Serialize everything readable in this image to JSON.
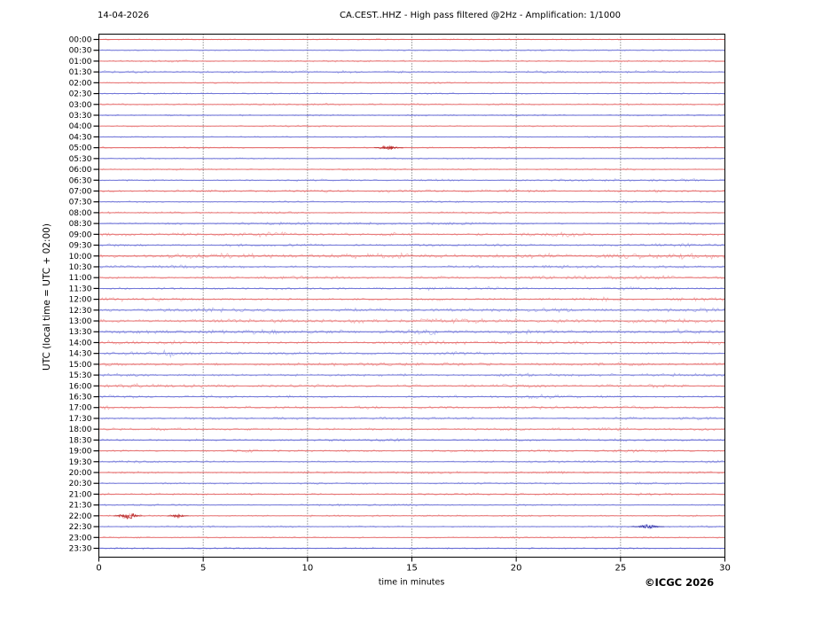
{
  "chart_data": {
    "type": "line",
    "subtype": "helicorder-seismogram",
    "date": "14-04-2026",
    "title": "CA.CEST..HHZ - High pass filtered @2Hz - Amplification: 1/1000",
    "station": "CA.CEST..HHZ",
    "filter": "High pass filtered @2Hz",
    "amplification": "1/1000",
    "ylabel": "UTC (local time = UTC + 02:00)",
    "xlabel": "time in minutes",
    "x_range_minutes": [
      0,
      30
    ],
    "x_ticks": [
      0,
      5,
      10,
      15,
      20,
      25,
      30
    ],
    "grid_minutes": [
      5,
      10,
      15,
      20,
      25
    ],
    "row_interval_minutes": 30,
    "grid_on": true,
    "colors": {
      "red_fuzz": "#f49b9b",
      "red_core": "#e05a5a",
      "red_dark": "#b32020",
      "blue_fuzz": "#9aa0ea",
      "blue_core": "#5a5fd0",
      "blue_dark": "#2828a0",
      "grid": "#444444",
      "frame": "#000000"
    },
    "rows": [
      {
        "label": "00:00",
        "color": "red",
        "noise": 0.55,
        "events": []
      },
      {
        "label": "00:30",
        "color": "blue",
        "noise": 0.5,
        "events": []
      },
      {
        "label": "01:00",
        "color": "red",
        "noise": 0.6,
        "events": []
      },
      {
        "label": "01:30",
        "color": "blue",
        "noise": 0.8,
        "events": []
      },
      {
        "label": "02:00",
        "color": "red",
        "noise": 0.55,
        "events": []
      },
      {
        "label": "02:30",
        "color": "blue",
        "noise": 0.5,
        "events": []
      },
      {
        "label": "03:00",
        "color": "red",
        "noise": 0.6,
        "events": []
      },
      {
        "label": "03:30",
        "color": "blue",
        "noise": 0.5,
        "events": []
      },
      {
        "label": "04:00",
        "color": "red",
        "noise": 0.55,
        "events": []
      },
      {
        "label": "04:30",
        "color": "blue",
        "noise": 0.5,
        "events": []
      },
      {
        "label": "05:00",
        "color": "red",
        "noise": 0.6,
        "events": [
          {
            "t": 13.9,
            "amp": 1.6,
            "w": 0.35
          }
        ]
      },
      {
        "label": "05:30",
        "color": "blue",
        "noise": 0.5,
        "events": []
      },
      {
        "label": "06:00",
        "color": "red",
        "noise": 0.6,
        "events": []
      },
      {
        "label": "06:30",
        "color": "blue",
        "noise": 0.7,
        "events": []
      },
      {
        "label": "07:00",
        "color": "red",
        "noise": 0.9,
        "events": []
      },
      {
        "label": "07:30",
        "color": "blue",
        "noise": 0.7,
        "events": []
      },
      {
        "label": "08:00",
        "color": "red",
        "noise": 0.7,
        "events": []
      },
      {
        "label": "08:30",
        "color": "blue",
        "noise": 0.7,
        "events": []
      },
      {
        "label": "09:00",
        "color": "red",
        "noise": 0.9,
        "events": [
          {
            "t": 8,
            "amp": 0.8,
            "w": 1.2
          },
          {
            "t": 22.5,
            "amp": 0.8,
            "w": 0.8
          }
        ]
      },
      {
        "label": "09:30",
        "color": "blue",
        "noise": 0.9,
        "events": [
          {
            "t": 6.5,
            "amp": 0.6,
            "w": 0.8
          }
        ]
      },
      {
        "label": "10:00",
        "color": "red",
        "noise": 1.5,
        "events": []
      },
      {
        "label": "10:30",
        "color": "blue",
        "noise": 0.95,
        "events": []
      },
      {
        "label": "11:00",
        "color": "red",
        "noise": 1.1,
        "events": []
      },
      {
        "label": "11:30",
        "color": "blue",
        "noise": 0.9,
        "events": [
          {
            "t": 1,
            "amp": 0.9,
            "w": 0.4
          },
          {
            "t": 8.8,
            "amp": 0.7,
            "w": 0.5
          }
        ]
      },
      {
        "label": "12:00",
        "color": "red",
        "noise": 1.05,
        "events": [
          {
            "t": 24,
            "amp": 0.7,
            "w": 0.6
          }
        ]
      },
      {
        "label": "12:30",
        "color": "blue",
        "noise": 1.25,
        "events": [
          {
            "t": 3.3,
            "amp": 0.9,
            "w": 0.4
          }
        ]
      },
      {
        "label": "13:00",
        "color": "red",
        "noise": 1.3,
        "events": [
          {
            "t": 20,
            "amp": 0.9,
            "w": 0.7
          }
        ]
      },
      {
        "label": "13:30",
        "color": "blue",
        "noise": 1.35,
        "events": [
          {
            "t": 8.3,
            "amp": 1.0,
            "w": 0.5
          },
          {
            "t": 16,
            "amp": 1.0,
            "w": 0.8
          },
          {
            "t": 20,
            "amp": 1.1,
            "w": 0.6
          },
          {
            "t": 27.5,
            "amp": 0.8,
            "w": 0.5
          }
        ]
      },
      {
        "label": "14:00",
        "color": "red",
        "noise": 1.15,
        "events": [
          {
            "t": 15,
            "amp": 0.8,
            "w": 0.7
          }
        ]
      },
      {
        "label": "14:30",
        "color": "blue",
        "noise": 0.95,
        "events": [
          {
            "t": 3.3,
            "amp": 1.0,
            "w": 0.5
          }
        ]
      },
      {
        "label": "15:00",
        "color": "red",
        "noise": 1.1,
        "events": []
      },
      {
        "label": "15:30",
        "color": "blue",
        "noise": 0.95,
        "events": []
      },
      {
        "label": "16:00",
        "color": "red",
        "noise": 1.05,
        "events": []
      },
      {
        "label": "16:30",
        "color": "blue",
        "noise": 0.95,
        "events": [
          {
            "t": 21.3,
            "amp": 0.9,
            "w": 0.8
          }
        ]
      },
      {
        "label": "17:00",
        "color": "red",
        "noise": 0.9,
        "events": [
          {
            "t": 0.5,
            "amp": 0.8,
            "w": 0.4
          }
        ]
      },
      {
        "label": "17:30",
        "color": "blue",
        "noise": 0.85,
        "events": []
      },
      {
        "label": "18:00",
        "color": "red",
        "noise": 0.9,
        "events": []
      },
      {
        "label": "18:30",
        "color": "blue",
        "noise": 0.8,
        "events": []
      },
      {
        "label": "19:00",
        "color": "red",
        "noise": 0.85,
        "events": []
      },
      {
        "label": "19:30",
        "color": "blue",
        "noise": 0.7,
        "events": []
      },
      {
        "label": "20:00",
        "color": "red",
        "noise": 0.7,
        "events": []
      },
      {
        "label": "20:30",
        "color": "blue",
        "noise": 0.65,
        "events": []
      },
      {
        "label": "21:00",
        "color": "red",
        "noise": 0.7,
        "events": [
          {
            "t": 26.5,
            "amp": 0.8,
            "w": 1.0
          }
        ]
      },
      {
        "label": "21:30",
        "color": "blue",
        "noise": 0.6,
        "events": []
      },
      {
        "label": "22:00",
        "color": "red",
        "noise": 0.6,
        "events": [
          {
            "t": 1.4,
            "amp": 2.6,
            "w": 0.35
          },
          {
            "t": 3.8,
            "amp": 1.2,
            "w": 0.25
          }
        ]
      },
      {
        "label": "22:30",
        "color": "blue",
        "noise": 0.6,
        "events": [
          {
            "t": 26.3,
            "amp": 1.6,
            "w": 0.4
          }
        ]
      },
      {
        "label": "23:00",
        "color": "red",
        "noise": 0.55,
        "events": []
      },
      {
        "label": "23:30",
        "color": "blue",
        "noise": 0.6,
        "events": []
      }
    ]
  },
  "footer": {
    "copyright": "©ICGC 2026"
  }
}
